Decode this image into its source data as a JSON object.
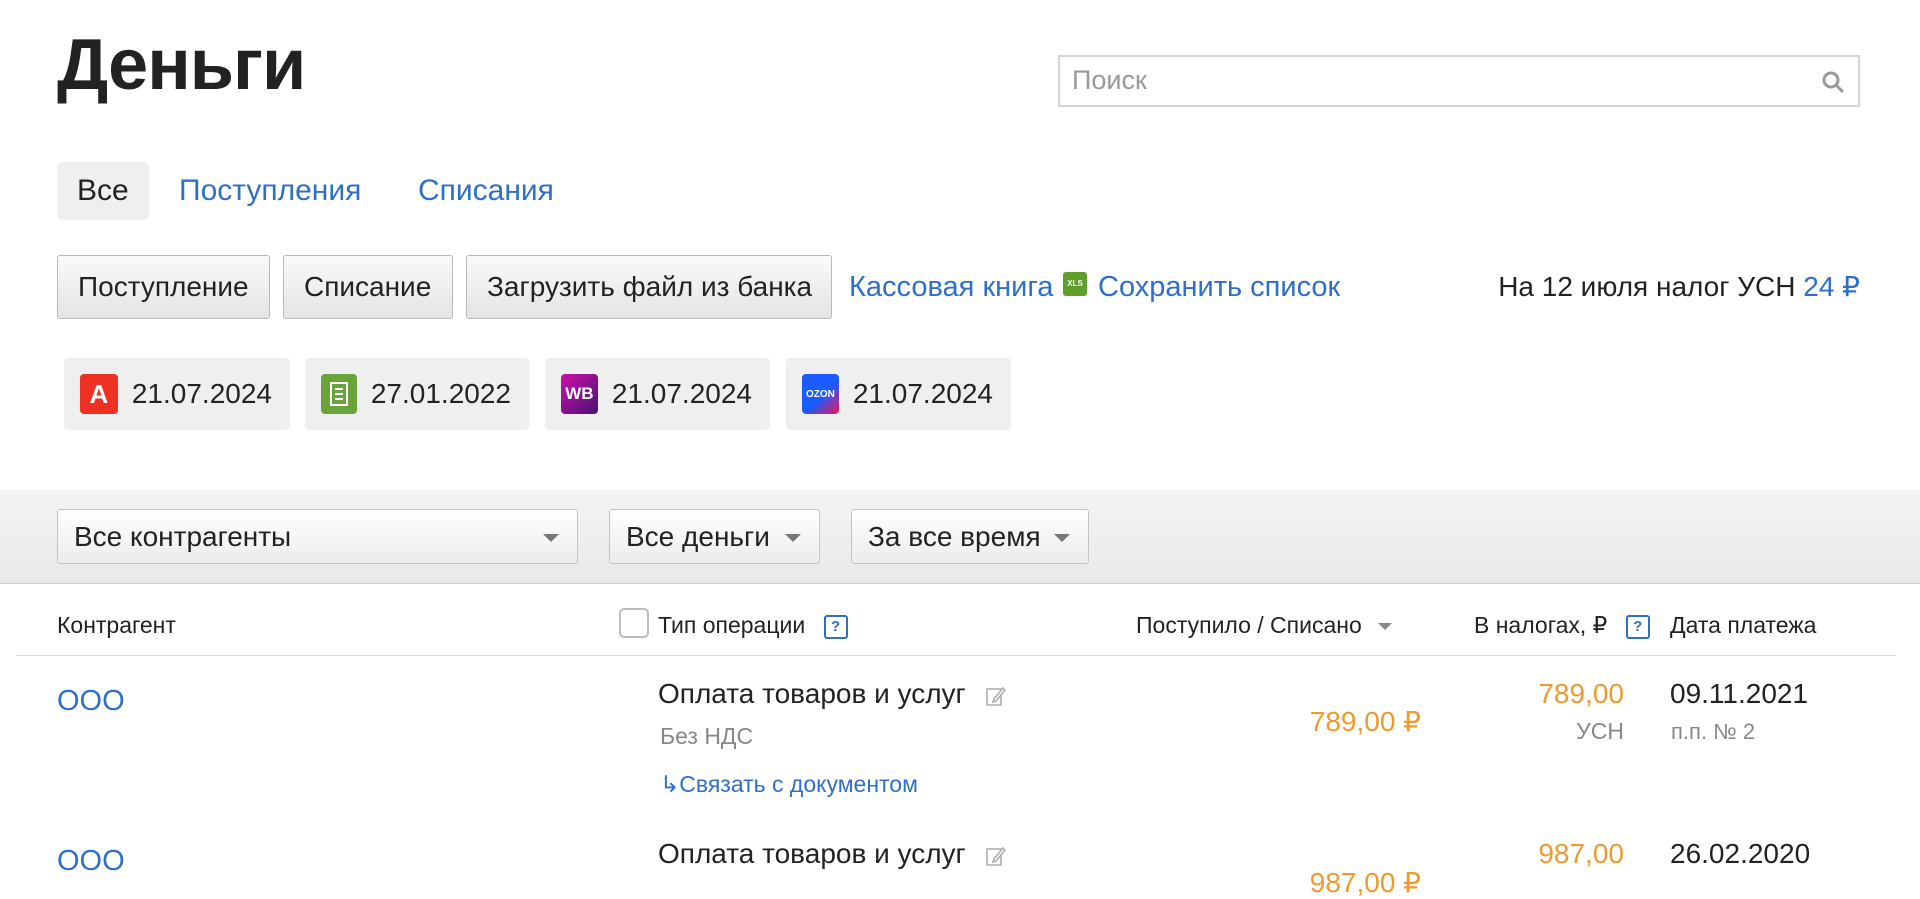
{
  "page": {
    "title": "Деньги"
  },
  "search": {
    "placeholder": "Поиск"
  },
  "tabs": [
    {
      "label": "Все",
      "active": true
    },
    {
      "label": "Поступления",
      "active": false
    },
    {
      "label": "Списания",
      "active": false
    }
  ],
  "toolbar": {
    "income_button": "Поступление",
    "expense_button": "Списание",
    "upload_button": "Загрузить файл из банка",
    "cashbook_link": "Кассовая книга",
    "xls_icon_label": "XLS",
    "save_list_link": "Сохранить список",
    "tax_text": "На 12 июля налог УСН",
    "tax_value": "24 ₽"
  },
  "accounts": [
    {
      "icon": "alfa-bank-icon",
      "glyph": "А",
      "color": "#ef3124",
      "date": "21.07.2024"
    },
    {
      "icon": "cash-register-icon",
      "glyph": "",
      "color": "#6aa33a",
      "date": "27.01.2022"
    },
    {
      "icon": "wildberries-icon",
      "glyph": "WB",
      "color": "#8e1a9c",
      "date": "21.07.2024"
    },
    {
      "icon": "ozon-icon",
      "glyph": "OZON",
      "color": "#1a5cff",
      "date": "21.07.2024"
    }
  ],
  "filters": {
    "counterparty": "Все контрагенты",
    "money": "Все деньги",
    "period": "За все время"
  },
  "table": {
    "headers": {
      "counterparty": "Контрагент",
      "operation_type": "Тип операции",
      "amount": "Поступило / Списано",
      "taxes": "В налогах, ₽",
      "payment_date": "Дата платежа"
    },
    "help_glyph": "?",
    "rows": [
      {
        "counterparty": "ООО",
        "operation": "Оплата товаров и услуг",
        "vat": "Без НДС",
        "doc_link": "Связать с документом",
        "amount": "789,00 ₽",
        "tax_amount": "789,00",
        "tax_label": "УСН",
        "date": "09.11.2021",
        "ref": "п.п. № 2"
      },
      {
        "counterparty": "ООО",
        "operation": "Оплата товаров и услуг",
        "amount": "987,00 ₽",
        "tax_amount": "987,00",
        "date": "26.02.2020"
      }
    ]
  },
  "colors": {
    "link": "#2f6fc6",
    "amount": "#ef9a2c",
    "muted": "#888888"
  }
}
